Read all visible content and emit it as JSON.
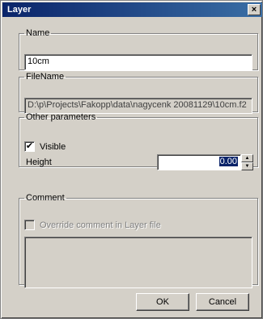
{
  "window": {
    "title": "Layer",
    "close_glyph": "×"
  },
  "name_group": {
    "legend": "Name",
    "value": "10cm"
  },
  "filename_group": {
    "legend": "FileName",
    "value": "D:\\p\\Projects\\Fakopp\\data\\nagycenk 20081129\\10cm.f2"
  },
  "other_group": {
    "legend": "Other parameters",
    "visible_label": "Visible",
    "visible_checked": "✔",
    "height_label": "Height",
    "height_value": "0.00",
    "spin_up": "▲",
    "spin_down": "▼"
  },
  "comment_group": {
    "legend": "Comment",
    "override_label": "Override comment in Layer file",
    "comment_text": ""
  },
  "buttons": {
    "ok": "OK",
    "cancel": "Cancel"
  }
}
